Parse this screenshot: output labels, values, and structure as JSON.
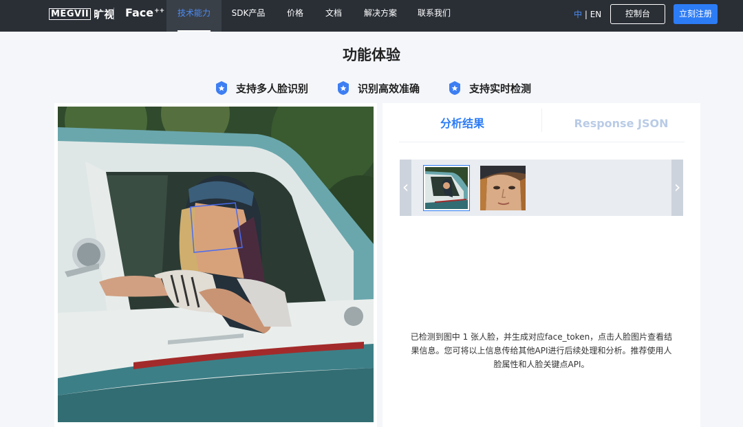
{
  "brand": {
    "megvii": "MEGVII",
    "megvii_cn": "旷视",
    "product": "Face",
    "product_sup": "++"
  },
  "nav": {
    "items": [
      {
        "label": "技术能力",
        "active": true
      },
      {
        "label": "SDK产品"
      },
      {
        "label": "价格"
      },
      {
        "label": "文档"
      },
      {
        "label": "解决方案"
      },
      {
        "label": "联系我们"
      }
    ],
    "lang_current": "中",
    "lang_sep": " | ",
    "lang_other": "EN",
    "console_label": "控制台",
    "register_label": "立刻注册"
  },
  "page": {
    "title": "功能体验",
    "features": [
      "支持多人脸识别",
      "识别高效准确",
      "支持实时检测"
    ]
  },
  "result_panel": {
    "tabs": [
      {
        "label": "分析结果",
        "active": true
      },
      {
        "label": "Response JSON",
        "active": false
      }
    ],
    "thumbnails_count": 2,
    "selected_thumbnail": 1,
    "description": "已检测到图中 1 张人脸，并生成对应face_token，点击人脸图片查看结果信息。您可将以上信息传给其他API进行后续处理和分析。推荐使用人脸属性和人脸关键点API。"
  },
  "colors": {
    "nav_bg": "#2a2f36",
    "accent": "#2c7cf6",
    "page_bg": "#f4f6fa",
    "face_box": "#4b6cf0"
  },
  "icons": {
    "feature_badge": "shield-star-icon",
    "carousel_prev": "chevron-left-icon",
    "carousel_next": "chevron-right-icon"
  }
}
